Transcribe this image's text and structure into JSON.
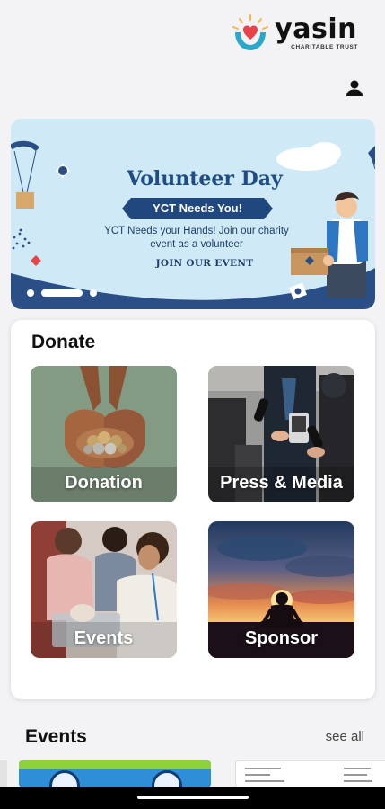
{
  "header": {
    "brand_name": "yasin",
    "brand_sub": "CHARITABLE TRUST"
  },
  "banner": {
    "title": "Volunteer Day",
    "pill": "YCT Needs You!",
    "description": "YCT Needs your Hands! Join our charity event as a volunteer",
    "cta": "JOIN OUR EVENT",
    "carousel_slide_count": 3,
    "carousel_active_index": 0
  },
  "donate": {
    "title": "Donate",
    "tiles": [
      {
        "label": "Donation",
        "image": "hands-holding-coins"
      },
      {
        "label": "Press & Media",
        "image": "microphones-reporters"
      },
      {
        "label": "Events",
        "image": "volunteers-sorting"
      },
      {
        "label": "Sponsor",
        "image": "person-meditating-sunset"
      }
    ]
  },
  "events": {
    "title": "Events",
    "see_all": "see all"
  },
  "colors": {
    "brand_navy": "#20487e",
    "banner_bg": "#cfeaf6",
    "accent_red": "#e8424b"
  }
}
